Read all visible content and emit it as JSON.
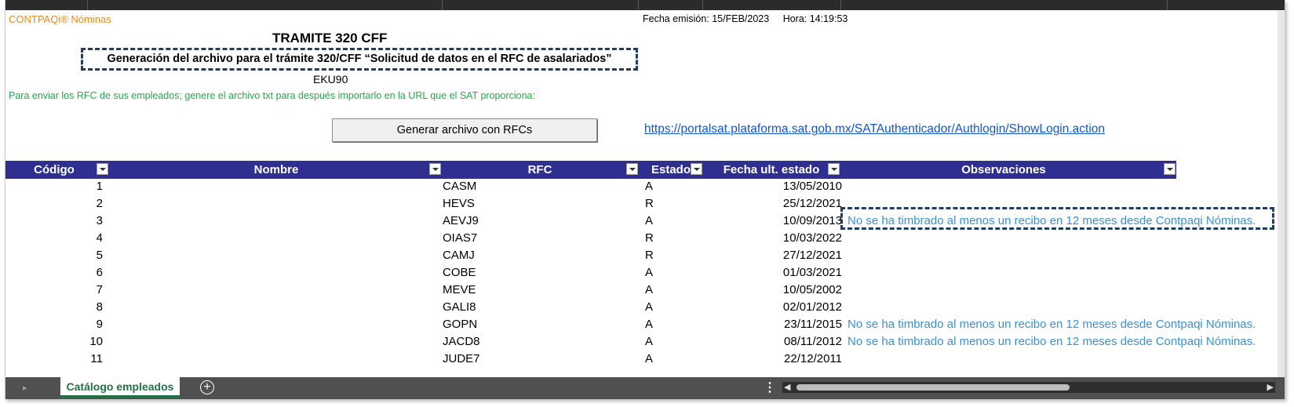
{
  "header": {
    "brand": "CONTPAQi® Nóminas",
    "issue_date": "Fecha emisión: 15/FEB/2023",
    "time": "Hora: 14:19:53"
  },
  "title": "TRAMITE 320 CFF",
  "subtitle": "Generación del archivo para el trámite 320/CFF “Solicitud de datos en el RFC de asalariados”",
  "company_rfc": "EKU90",
  "instructions": "Para enviar los RFC de sus empleados; genere el archivo txt para después importarlo en la  URL que el SAT proporciona:",
  "generate_button": "Generar archivo con RFCs",
  "sat_url": "https://portalsat.plataforma.sat.gob.mx/SATAuthenticador/Authlogin/ShowLogin.action",
  "table": {
    "columns": [
      "Código",
      "Nombre",
      "RFC",
      "Estado",
      "Fecha ult. estado",
      "Observaciones"
    ],
    "rows": [
      {
        "codigo": "1",
        "rfc": "CASM",
        "estado": "A",
        "fecha": "13/05/2010",
        "obs": ""
      },
      {
        "codigo": "2",
        "rfc": "HEVS",
        "estado": "R",
        "fecha": "25/12/2021",
        "obs": ""
      },
      {
        "codigo": "3",
        "rfc": "AEVJ9",
        "estado": "A",
        "fecha": "10/09/2013",
        "obs": "No se ha timbrado al menos un recibo en 12 meses desde Contpaqi Nóminas."
      },
      {
        "codigo": "4",
        "rfc": "OIAS7",
        "estado": "R",
        "fecha": "10/03/2022",
        "obs": ""
      },
      {
        "codigo": "5",
        "rfc": "CAMJ",
        "estado": "R",
        "fecha": "27/12/2021",
        "obs": ""
      },
      {
        "codigo": "6",
        "rfc": "COBE",
        "estado": "A",
        "fecha": "01/03/2021",
        "obs": ""
      },
      {
        "codigo": "7",
        "rfc": "MEVE",
        "estado": "A",
        "fecha": "10/05/2002",
        "obs": ""
      },
      {
        "codigo": "8",
        "rfc": "GALI8",
        "estado": "A",
        "fecha": "02/01/2012",
        "obs": ""
      },
      {
        "codigo": "9",
        "rfc": "GOPN",
        "estado": "A",
        "fecha": "23/11/2015",
        "obs": "No se ha timbrado al menos un recibo en 12 meses desde Contpaqi Nóminas."
      },
      {
        "codigo": "10",
        "rfc": "JACD8",
        "estado": "A",
        "fecha": "08/11/2012",
        "obs": "No se ha timbrado al menos un recibo en 12 meses desde Contpaqi Nóminas."
      },
      {
        "codigo": "11",
        "rfc": "JUDE7",
        "estado": "A",
        "fecha": "22/12/2011",
        "obs": ""
      }
    ]
  },
  "sheet_tabs": [
    "Catálogo empleados"
  ],
  "colors": {
    "brand": "#e68a1f",
    "instructions": "#1faa4a",
    "table_header": "#2e2f91",
    "observation": "#3a8fd9",
    "link": "#1155cc",
    "tab_active": "#217346"
  },
  "icons": {
    "add_sheet": "plus-circle-icon",
    "filter": "dropdown-filter-icon",
    "more": "vertical-dots-icon"
  }
}
